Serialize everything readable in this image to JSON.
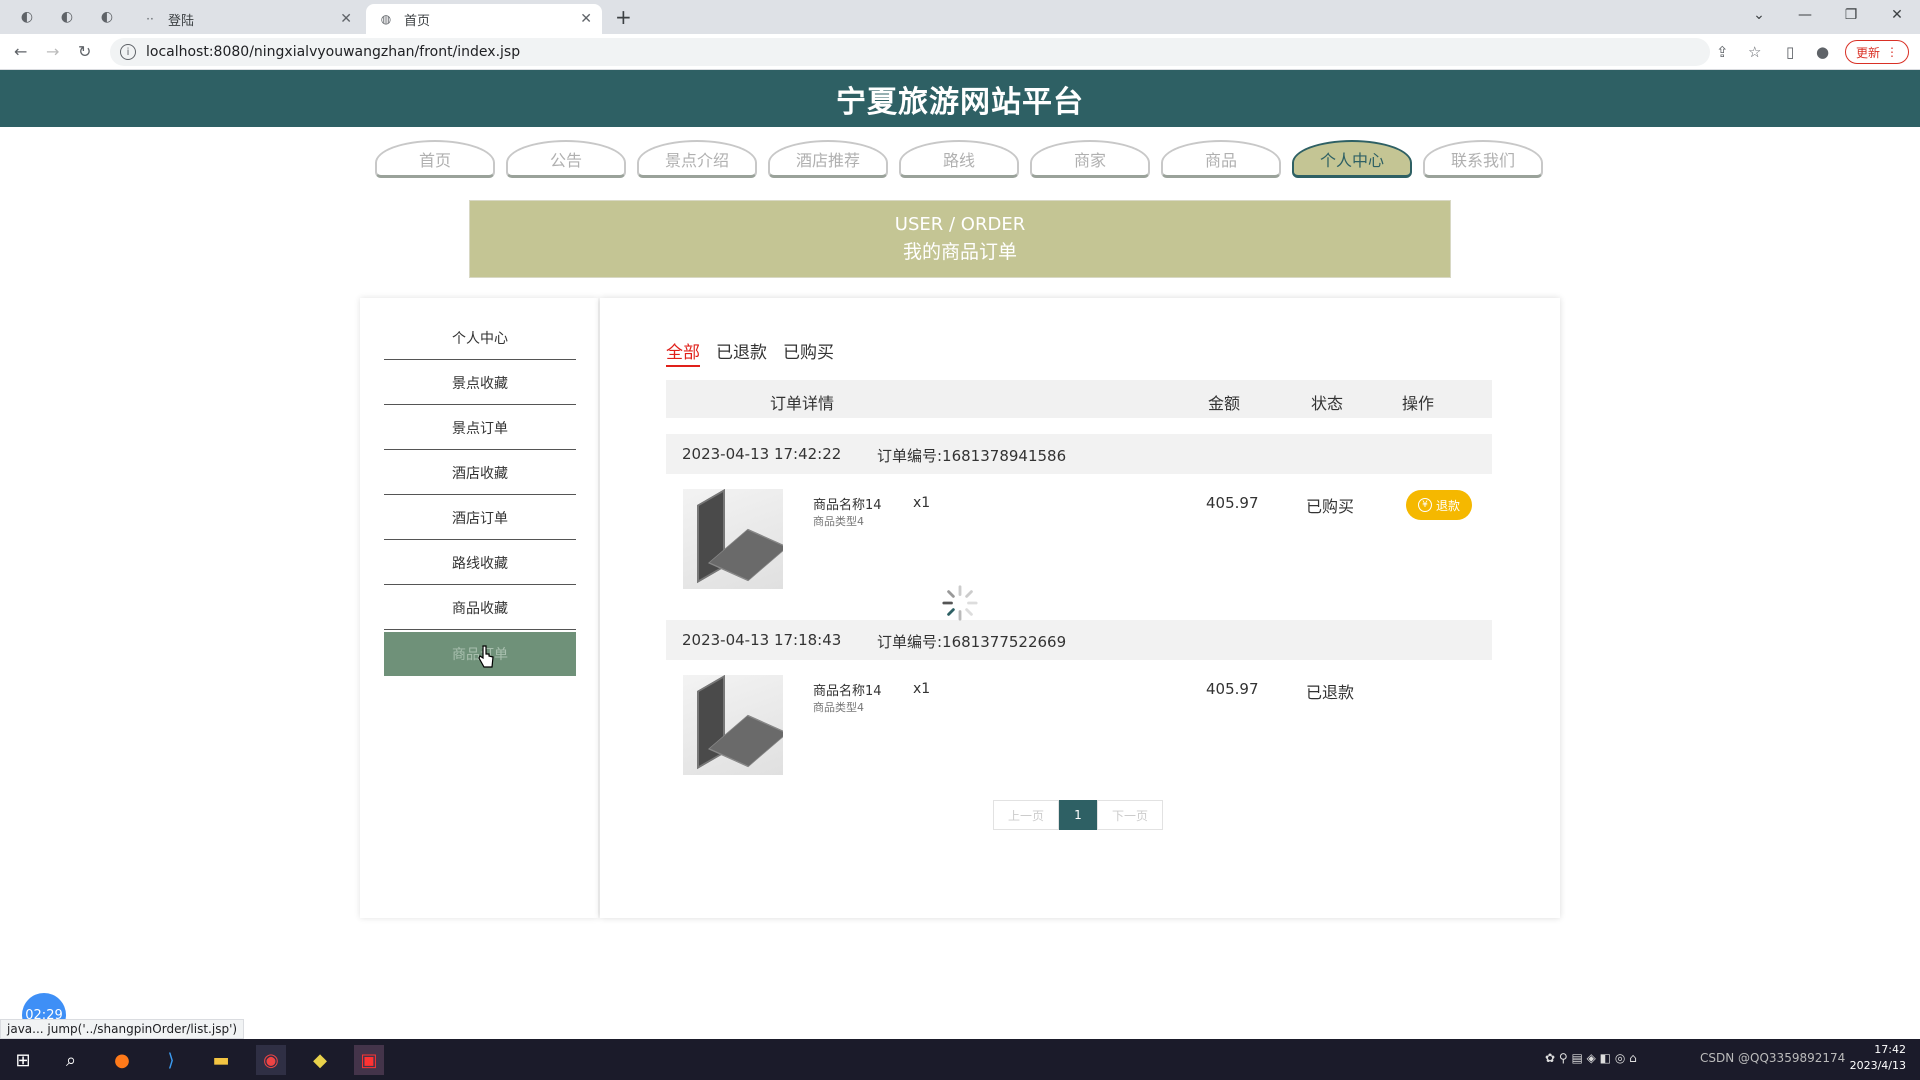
{
  "browser": {
    "tabs": [
      {
        "title": "登陆",
        "active": false
      },
      {
        "title": "首页",
        "active": true
      }
    ],
    "url": "localhost:8080/ningxialvyouwangzhan/front/index.jsp",
    "update_label": "更新",
    "status_url": "java... jump('../shangpinOrder/list.jsp')"
  },
  "site": {
    "title": "宁夏旅游网站平台",
    "nav": [
      "首页",
      "公告",
      "景点介绍",
      "酒店推荐",
      "路线",
      "商家",
      "商品",
      "个人中心",
      "联系我们"
    ],
    "nav_active": "个人中心",
    "banner": {
      "en": "USER / ORDER",
      "cn": "我的商品订单"
    }
  },
  "sidebar": {
    "items": [
      "个人中心",
      "景点收藏",
      "景点订单",
      "酒店收藏",
      "酒店订单",
      "路线收藏",
      "商品收藏",
      "商品订单"
    ],
    "active": "商品订单"
  },
  "orders": {
    "filters": [
      "全部",
      "已退款",
      "已购买"
    ],
    "active_filter": "全部",
    "columns": {
      "detail": "订单详情",
      "amount": "金额",
      "status": "状态",
      "action": "操作"
    },
    "list": [
      {
        "time": "2023-04-13 17:42:22",
        "number": "订单编号:1681378941586",
        "name": "商品名称14",
        "type": "商品类型4",
        "qty": "x1",
        "amount": "405.97",
        "status": "已购买",
        "action": "退款"
      },
      {
        "time": "2023-04-13 17:18:43",
        "number": "订单编号:1681377522669",
        "name": "商品名称14",
        "type": "商品类型4",
        "qty": "x1",
        "amount": "405.97",
        "status": "已退款",
        "action": ""
      }
    ],
    "pager": {
      "prev": "上一页",
      "current": "1",
      "next": "下一页"
    }
  },
  "overlay": {
    "timer": "02:29"
  },
  "taskbar": {
    "time": "17:42",
    "date": "2023/4/13",
    "watermark": "CSDN @QQ3359892174"
  }
}
